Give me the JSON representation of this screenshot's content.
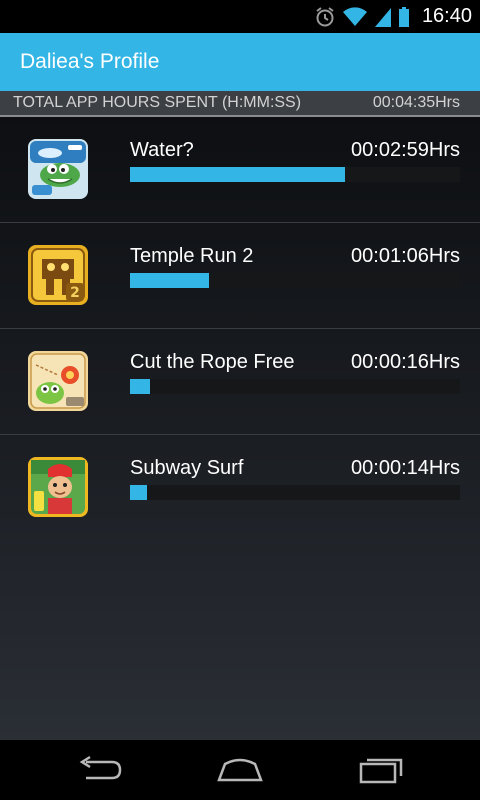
{
  "status_bar": {
    "time": "16:40"
  },
  "action_bar": {
    "title": "Daliea's Profile"
  },
  "summary": {
    "label": "TOTAL APP HOURS SPENT (H:MM:SS)",
    "total": "00:04:35Hrs"
  },
  "apps": [
    {
      "name": "Water?",
      "time": "00:02:59Hrs",
      "share": 0.65,
      "icon": "water-game-icon",
      "badge": "free"
    },
    {
      "name": "Temple Run 2",
      "time": "00:01:06Hrs",
      "share": 0.24,
      "icon": "temple-run-icon",
      "badge": "2"
    },
    {
      "name": "Cut the Rope Free",
      "time": "00:00:16Hrs",
      "share": 0.06,
      "icon": "cut-the-rope-icon",
      "badge": "FREE"
    },
    {
      "name": "Subway Surf",
      "time": "00:00:14Hrs",
      "share": 0.05,
      "icon": "subway-surf-icon",
      "badge": ""
    }
  ],
  "colors": {
    "accent": "#33b5e5",
    "summary_bg": "#3c3f44",
    "track": "#151719"
  },
  "nav": [
    "back-icon",
    "home-icon",
    "recent-apps-icon"
  ]
}
